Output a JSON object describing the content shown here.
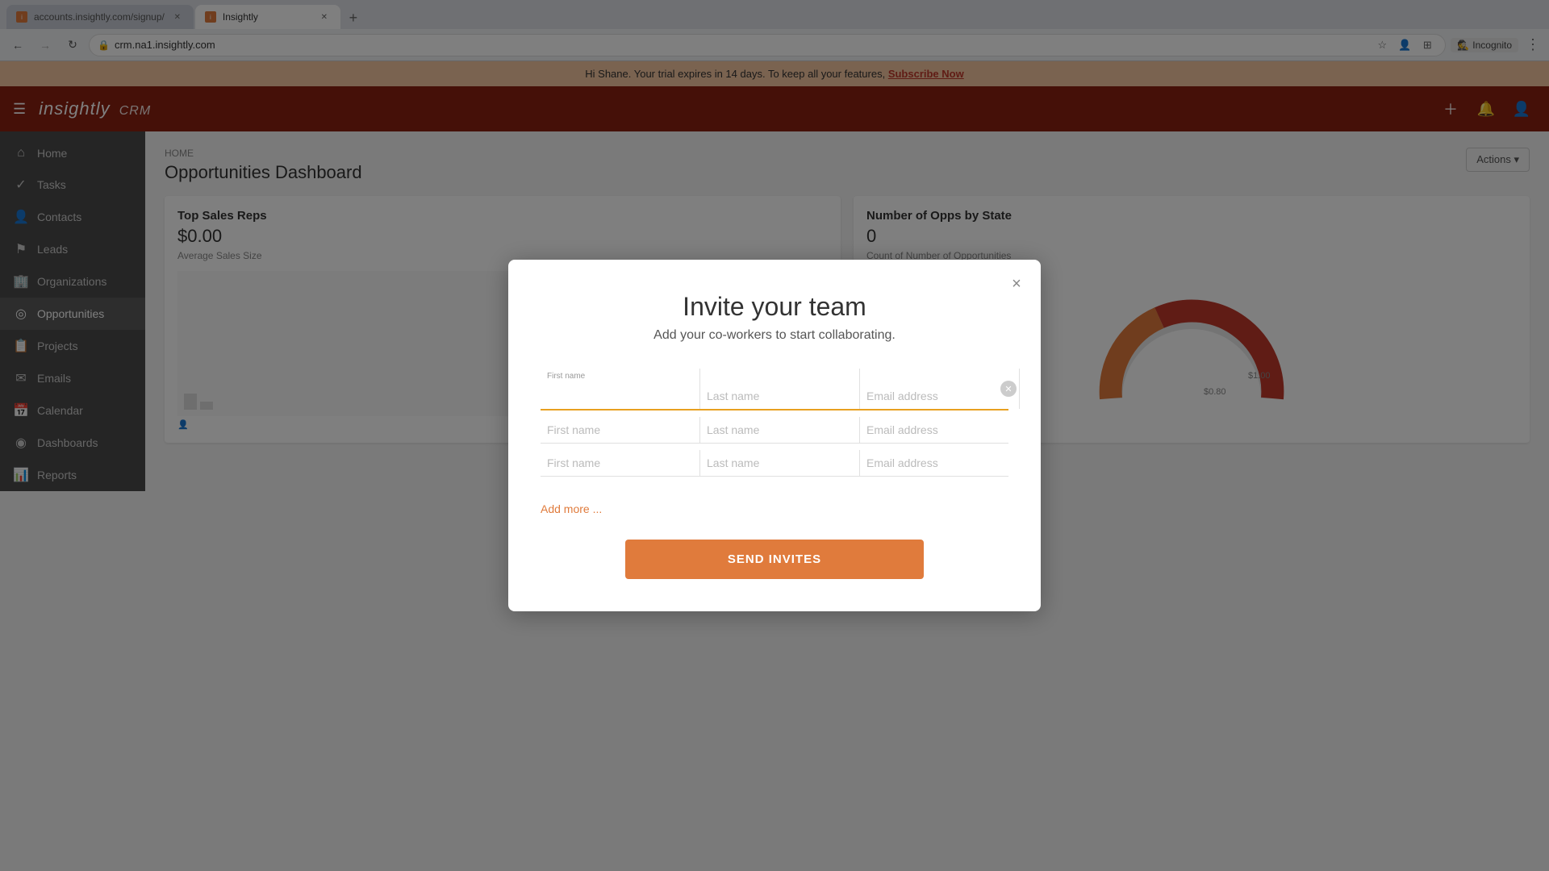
{
  "browser": {
    "tabs": [
      {
        "id": "signup",
        "favicon_color": "#e07b3c",
        "label": "accounts.insightly.com/signup/",
        "active": false
      },
      {
        "id": "insightly",
        "favicon_color": "#e07b3c",
        "label": "Insightly",
        "active": true
      }
    ],
    "address": "crm.na1.insightly.com",
    "incognito_label": "Incognito",
    "nav": {
      "back_disabled": false,
      "forward_disabled": true
    }
  },
  "trial_banner": {
    "text": "Hi Shane. Your trial expires in 14 days. To keep all your features,",
    "link_text": "Subscribe Now"
  },
  "header": {
    "logo": "insightly",
    "crm_label": "CRM"
  },
  "sidebar": {
    "items": [
      {
        "id": "home",
        "label": "Home",
        "icon": "🏠"
      },
      {
        "id": "tasks",
        "label": "Tasks",
        "icon": "✓"
      },
      {
        "id": "contacts",
        "label": "Contacts",
        "icon": "👤"
      },
      {
        "id": "leads",
        "label": "Leads",
        "icon": "⚐"
      },
      {
        "id": "organizations",
        "label": "Organizations",
        "icon": "🏢"
      },
      {
        "id": "opportunities",
        "label": "Opportunities",
        "icon": "◎"
      },
      {
        "id": "projects",
        "label": "Projects",
        "icon": "📋"
      },
      {
        "id": "emails",
        "label": "Emails",
        "icon": "✉"
      },
      {
        "id": "calendar",
        "label": "Calendar",
        "icon": "📅"
      },
      {
        "id": "dashboards",
        "label": "Dashboards",
        "icon": "◉"
      },
      {
        "id": "reports",
        "label": "Reports",
        "icon": "📊"
      }
    ]
  },
  "page": {
    "breadcrumb": "HOME",
    "title": "Opportunities Dashboard",
    "actions_label": "Actions ▾"
  },
  "dashboard": {
    "top_sales_reps": {
      "title": "Top Sales Reps",
      "value": "$0.00",
      "sub": "Average Sales Size"
    },
    "opps_by_state": {
      "title": "Number of Opps by State",
      "value": "0",
      "sub": "Count of Number of Opportunities"
    }
  },
  "modal": {
    "close_icon": "×",
    "title": "Invite your team",
    "subtitle": "Add your co-workers to start collaborating.",
    "rows": [
      {
        "id": "row1",
        "first_name_label": "First name",
        "first_name_value": "",
        "last_name_placeholder": "Last name",
        "email_placeholder": "Email address",
        "active": true,
        "has_clear": true
      },
      {
        "id": "row2",
        "first_name_placeholder": "First name",
        "last_name_placeholder": "Last name",
        "email_placeholder": "Email address",
        "active": false,
        "has_clear": false
      },
      {
        "id": "row3",
        "first_name_placeholder": "First name",
        "last_name_placeholder": "Last name",
        "email_placeholder": "Email address",
        "active": false,
        "has_clear": false
      }
    ],
    "add_more_label": "Add more ...",
    "send_invites_label": "SEND INVITES"
  }
}
